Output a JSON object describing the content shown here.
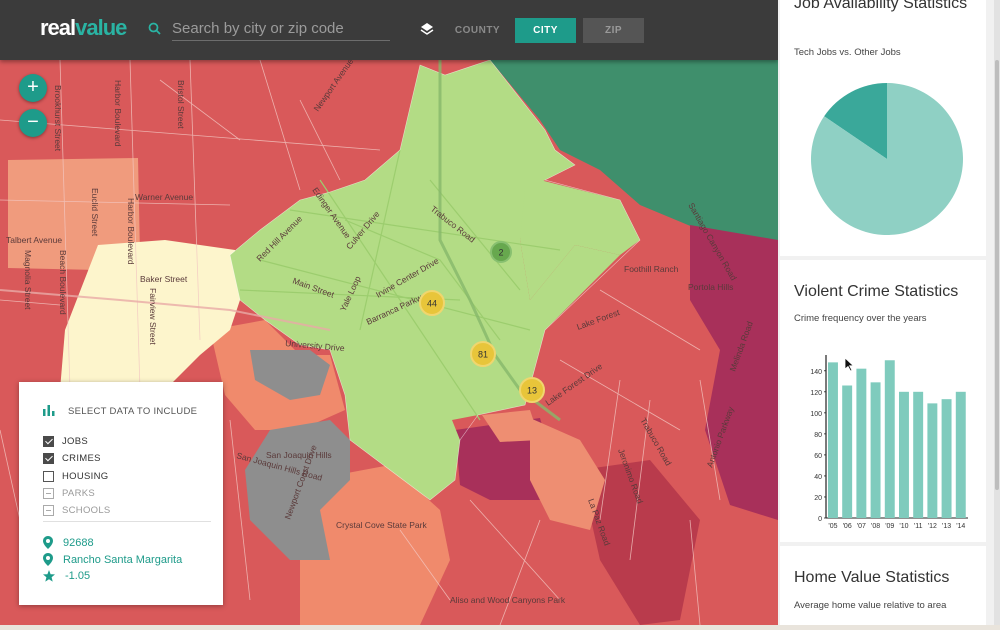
{
  "app": {
    "logo_white": "real",
    "logo_teal": "value"
  },
  "search": {
    "placeholder": "Search by city or zip code"
  },
  "view_modes": {
    "county": "COUNTY",
    "city": "CITY",
    "zip": "ZIP",
    "active": "city"
  },
  "zoom": {
    "in": "+",
    "out": "−"
  },
  "map": {
    "streets": [
      "Brookhurst Street",
      "Harbor Boulevard",
      "Bristol Street",
      "Newport Avenue",
      "Warner Avenue",
      "Euclid Street",
      "Talbert Avenue",
      "Edinger Avenue",
      "Red Hill Avenue",
      "Culver Drive",
      "Trabuco Road",
      "Harbor Boulevard",
      "Fairview Street",
      "Baker Street",
      "Magnolia Street",
      "Beach Boulevard",
      "Main Street",
      "Barranca Parkway",
      "Irvine Center Drive",
      "Yale Loop",
      "University Drive",
      "Foothill Ranch",
      "Portola Hills",
      "Santiago Canyon Road",
      "Lake Forest Drive",
      "Jeronimo Road",
      "Trabuco Road",
      "San Joaquin Hills",
      "San Joaquin Hills Road",
      "Newport Coast Drive",
      "Crystal Cove State Park",
      "Aliso and Wood Canyons Park",
      "La Paz Road",
      "Antonio Parkway",
      "Melinda Road",
      "Lake Forest"
    ],
    "clusters": [
      {
        "count": "2",
        "color": "#67a84e"
      },
      {
        "count": "44",
        "color": "#e8c53a"
      },
      {
        "count": "81",
        "color": "#e8c53a"
      },
      {
        "count": "13",
        "color": "#e8c53a"
      }
    ]
  },
  "data_panel": {
    "title": "SELECT DATA TO INCLUDE",
    "options": [
      {
        "label": "JOBS",
        "state": "checked"
      },
      {
        "label": "CRIMES",
        "state": "checked"
      },
      {
        "label": "HOUSING",
        "state": "unchecked"
      },
      {
        "label": "PARKS",
        "state": "disabled"
      },
      {
        "label": "SCHOOLS",
        "state": "disabled"
      }
    ],
    "zip": "92688",
    "city": "Rancho Santa Margarita",
    "score": "-1.05"
  },
  "sidebar": {
    "jobs_title": "Job Availability Statistics",
    "jobs_subtitle": "Tech Jobs vs. Other Jobs",
    "crime_title": "Violent Crime Statistics",
    "crime_subtitle": "Crime frequency over the years",
    "home_title": "Home Value Statistics",
    "home_subtitle": "Average home value relative to area"
  },
  "chart_data": [
    {
      "type": "pie",
      "slices": [
        {
          "label": "Tech Jobs",
          "value": 0.155,
          "color": "#3aa89a"
        },
        {
          "label": "Other Jobs",
          "value": 0.845,
          "color": "#8fd0c4"
        }
      ]
    },
    {
      "type": "bar",
      "categories": [
        "'05",
        "'06",
        "'07",
        "'08",
        "'09",
        "'10",
        "'11",
        "'12",
        "'13",
        "'14"
      ],
      "values": [
        148,
        126,
        142,
        129,
        150,
        120,
        120,
        109,
        113,
        120
      ],
      "yticks": [
        "0",
        "20",
        "40",
        "60",
        "80",
        "100",
        "120",
        "140"
      ],
      "ylim": [
        0,
        155
      ],
      "color": "#7fcbbd"
    }
  ],
  "colors": {
    "accent": "#1e9b8a",
    "topbar": "#3b3b3b"
  }
}
